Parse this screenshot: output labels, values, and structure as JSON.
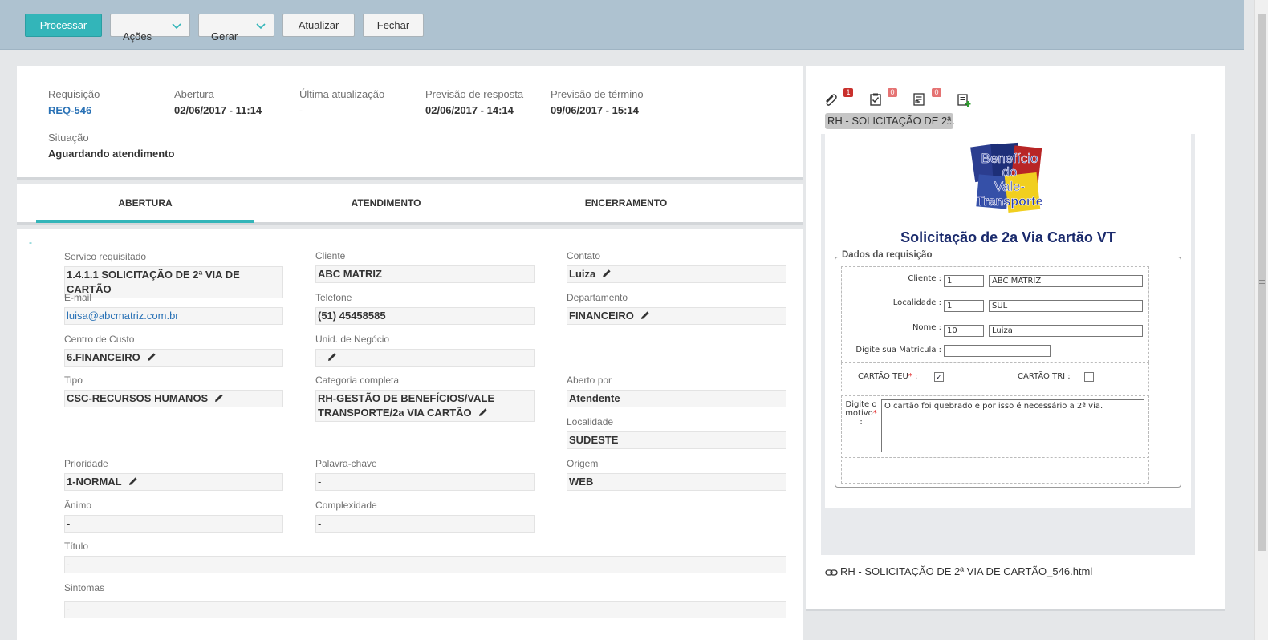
{
  "toolbar": {
    "process": "Processar",
    "actions": "Ações",
    "generate": "Gerar",
    "refresh": "Atualizar",
    "close": "Fechar"
  },
  "header": {
    "request_label": "Requisição",
    "request_value": "REQ-546",
    "opening_label": "Abertura",
    "opening_value": "02/06/2017 - 11:14",
    "last_update_label": "Última atualização",
    "last_update_value": "-",
    "response_forecast_label": "Previsão de resposta",
    "response_forecast_value": "02/06/2017 - 14:14",
    "end_forecast_label": "Previsão de término",
    "end_forecast_value": "09/06/2017 - 15:14",
    "status_label": "Situação",
    "status_value": "Aguardando atendimento"
  },
  "tabs": [
    "ABERTURA",
    "ATENDIMENTO",
    "ENCERRAMENTO"
  ],
  "form": {
    "collapse": "-",
    "service": {
      "label": "Servico requisitado",
      "value": "1.4.1.1 SOLICITAÇÃO DE 2ª VIA DE CARTÃO"
    },
    "client": {
      "label": "Cliente",
      "value": "ABC MATRIZ"
    },
    "contact": {
      "label": "Contato",
      "value": "Luiza"
    },
    "email": {
      "label": "E-mail",
      "value": "luisa@abcmatriz.com.br"
    },
    "phone": {
      "label": "Telefone",
      "value": "(51) 45458585"
    },
    "department": {
      "label": "Departamento",
      "value": "FINANCEIRO"
    },
    "cost_center": {
      "label": "Centro de Custo",
      "value": "6.FINANCEIRO"
    },
    "business_unit": {
      "label": "Unid. de Negócio",
      "value": "-"
    },
    "type": {
      "label": "Tipo",
      "value": "CSC-RECURSOS HUMANOS"
    },
    "category": {
      "label": "Categoria completa",
      "value": "RH-GESTÃO DE BENEFÍCIOS/VALE TRANSPORTE/2a VIA CARTÃO"
    },
    "opened_by": {
      "label": "Aberto por",
      "value": "Atendente"
    },
    "location": {
      "label": "Localidade",
      "value": "SUDESTE"
    },
    "priority": {
      "label": "Prioridade",
      "value": "1-NORMAL"
    },
    "keyword": {
      "label": "Palavra-chave",
      "value": "-"
    },
    "origin": {
      "label": "Origem",
      "value": "WEB"
    },
    "mood": {
      "label": "Ânimo",
      "value": "-"
    },
    "complexity": {
      "label": "Complexidade",
      "value": "-"
    },
    "title": {
      "label": "Título",
      "value": "-"
    },
    "symptoms": {
      "label": "Sintomas",
      "value": "-"
    }
  },
  "right_panel": {
    "badges": {
      "attachments": "1",
      "tasks": "0",
      "forms": "0"
    },
    "doc_chip": "RH - SOLICITAÇÃO DE 2ª",
    "doc_chip_ellipsis": "...",
    "preview": {
      "logo_lines": [
        "Benefício",
        "do",
        "Vale-",
        "Transporte"
      ],
      "title": "Solicitação de 2a Via Cartão VT",
      "legend": "Dados da requisição",
      "client_label": "Cliente :",
      "client_code": "1",
      "client_name": "ABC MATRIZ",
      "locality_label": "Localidade :",
      "locality_code": "1",
      "locality_name": "SUL",
      "name_label": "Nome :",
      "name_code": "10",
      "name_value": "Luiza",
      "registration_label": "Digite sua Matrícula :",
      "registration_value": "",
      "card_teu_label": "CARTÃO TEU",
      "card_tri_label": "CARTÃO TRI :",
      "reason_label_1": "Digite o",
      "reason_label_2": "motivo",
      "reason_value": "O cartão foi quebrado e por isso é necessário a 2ª via."
    },
    "attachment": "RH - SOLICITAÇÃO DE 2ª VIA DE CARTÃO_546.html"
  }
}
